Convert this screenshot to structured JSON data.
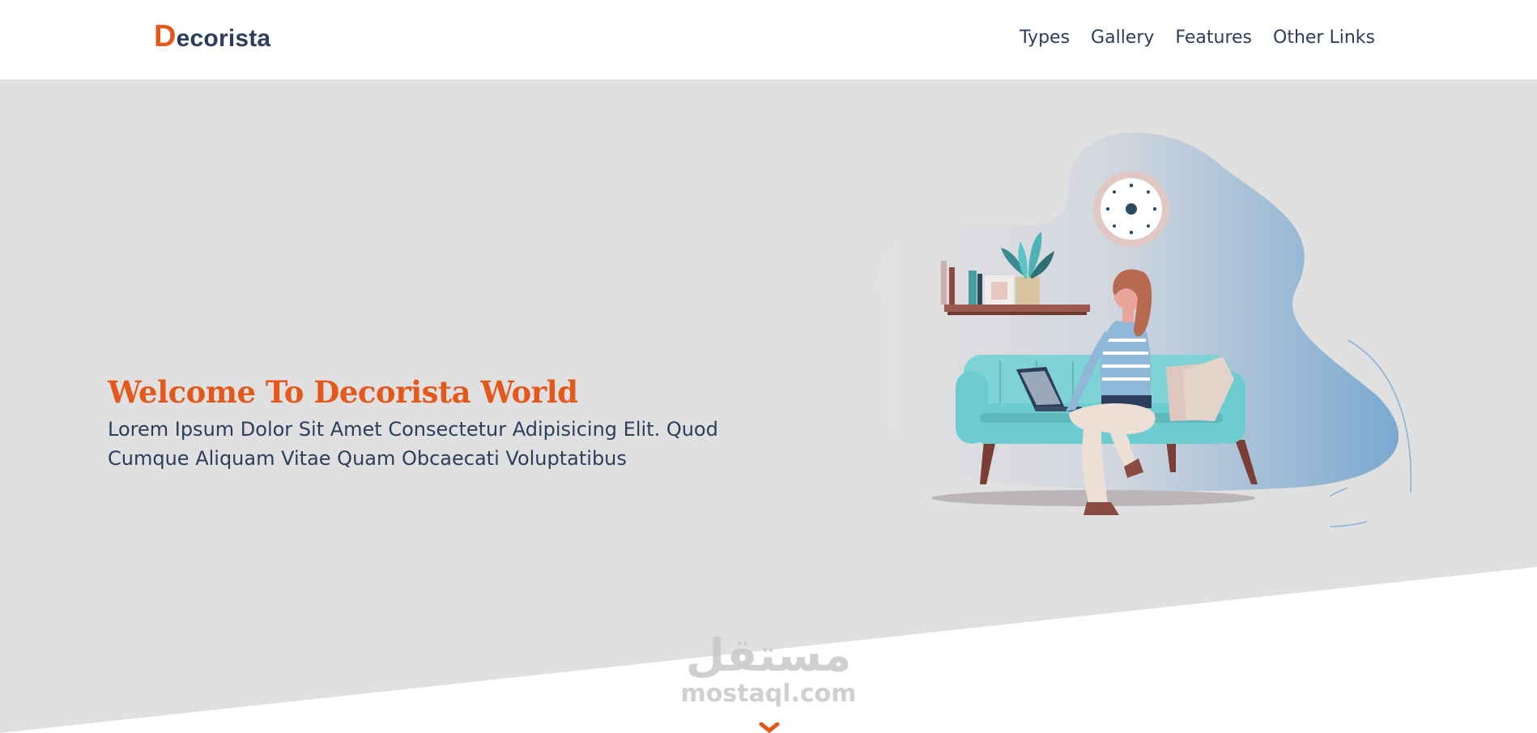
{
  "header": {
    "logo_first_letter": "D",
    "logo_rest": "ecorista",
    "nav": [
      {
        "label": "Types"
      },
      {
        "label": "Gallery"
      },
      {
        "label": "Features"
      },
      {
        "label": "Other Links"
      }
    ]
  },
  "hero": {
    "title": "Welcome To Decorista World",
    "description": "Lorem Ipsum Dolor Sit Amet Consectetur Adipisicing Elit. Quod Cumque Aliquam Vitae Quam Obcaecati Voluptatibus"
  },
  "watermark": {
    "arabic": "مستقل",
    "latin": "mostaql.com"
  },
  "icons": {
    "scroll_down": "chevron-down-icon"
  },
  "colors": {
    "accent": "#e5581b",
    "text": "#2c3e5c",
    "landing_bg": "#e0e0e1",
    "sofa": "#7dd3d5"
  }
}
